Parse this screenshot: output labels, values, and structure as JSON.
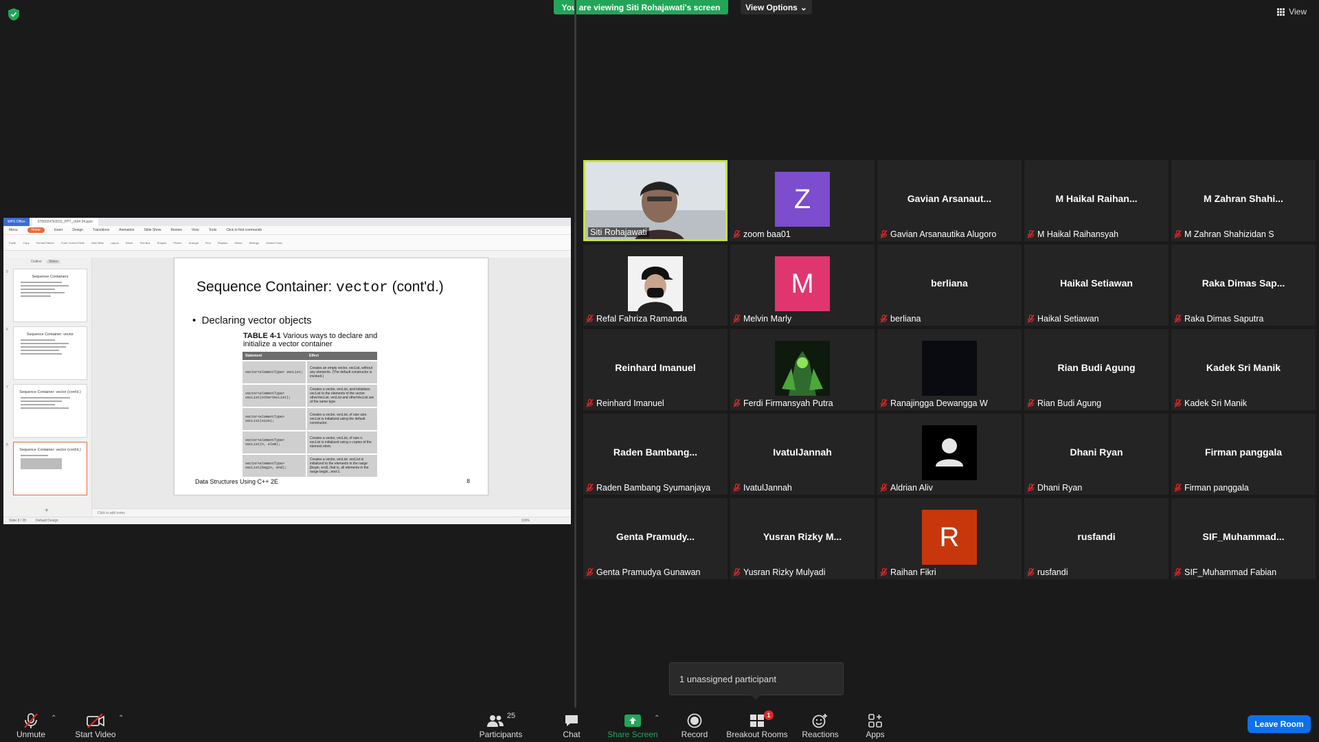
{
  "top": {
    "banner": "You are viewing Siti Rohajawati's screen",
    "view_options": "View Options",
    "view": "View"
  },
  "shared": {
    "app_tab": "WPS Office",
    "doc_tab": "97800247E0011_PPT_ch04 04.pptx",
    "menu": [
      "Menu",
      "Home",
      "Insert",
      "Design",
      "Transitions",
      "Animation",
      "Slide Show",
      "Review",
      "View",
      "Tools",
      "Click to find commands"
    ],
    "ribbon": [
      "Paste",
      "Copy",
      "Format Painter",
      "From Current Slide",
      "New Slide",
      "Layout",
      "Reset",
      "Text Box",
      "Shapes",
      "Picture",
      "Arrange",
      "Find",
      "Replace",
      "Select",
      "Settings",
      "Student Tools"
    ],
    "thumb_tabs": [
      "Outline",
      "Slides"
    ],
    "thumbs": [
      {
        "num": "5",
        "title": "Sequence Containers"
      },
      {
        "num": "6",
        "title": "Sequence Container: vector"
      },
      {
        "num": "7",
        "title": "Sequence Container: vector (cont'd.)"
      },
      {
        "num": "8",
        "title": "Sequence Container: vector (cont'd.)"
      }
    ],
    "slide": {
      "title_a": "Sequence Container: ",
      "title_mono": "vector",
      "title_b": " (cont'd.)",
      "bullet": "Declaring vector objects",
      "caption_bold": "TABLE 4-1",
      "caption_rest": " Various ways to declare and initialize a vector container",
      "col_statement": "Statement",
      "col_effect": "Effect",
      "rows": [
        {
          "stmt": "vector<elementType> vecList;",
          "effect": "Creates an empty vector, vecList, without any elements. (The default constructor is invoked.)"
        },
        {
          "stmt": "vector<elementType> vecList(otherVecList);",
          "effect": "Creates a vector, vecList, and initializes vecList to the elements of the vector otherVecList. vecList and otherVecList are of the same type."
        },
        {
          "stmt": "vector<elementType> vecList(size);",
          "effect": "Creates a vector, vecList, of size size. vecList is initialized using the default constructor."
        },
        {
          "stmt": "vector<elementType> vecList(n, elem);",
          "effect": "Creates a vector, vecList, of size n. vecList is initialized using n copies of the element elem."
        },
        {
          "stmt": "vector<elementType> vecList(begin, end);",
          "effect": "Creates a vector, vecList. vecList is initialized to the elements in the range [begin, end), that is, all elements in the range begin...end-1."
        }
      ],
      "footer": "Data Structures Using C++ 2E",
      "page": "8"
    },
    "notes": "Click to add notes",
    "status_left": "Slide 8 / 28",
    "status_design": "Default Design",
    "zoom": "119%"
  },
  "participants": [
    {
      "display": "",
      "label": "Siti Rohajawati",
      "type": "video",
      "muted": false,
      "speaking": true
    },
    {
      "display": "Z",
      "label": "zoom baa01",
      "type": "avatar",
      "color": "#7c4dcc",
      "muted": true
    },
    {
      "display": "Gavian  Arsanaut...",
      "label": "Gavian Arsanautika Alugoro",
      "type": "name",
      "muted": true
    },
    {
      "display": "M  Haikal  Raihan...",
      "label": "M Haikal Raihansyah",
      "type": "name",
      "muted": true
    },
    {
      "display": "M  Zahran  Shahi...",
      "label": "M Zahran Shahizidan S",
      "type": "name",
      "muted": true
    },
    {
      "display": "",
      "label": "Refal Fahriza Ramanda",
      "type": "photo-cap",
      "muted": true
    },
    {
      "display": "M",
      "label": "Melvin Marly",
      "type": "avatar",
      "color": "#e0356e",
      "muted": true
    },
    {
      "display": "berliana",
      "label": "berliana",
      "type": "name",
      "muted": true
    },
    {
      "display": "Haikal Setiawan",
      "label": "Haikal Setiawan",
      "type": "name",
      "muted": true
    },
    {
      "display": "Raka  Dimas  Sap...",
      "label": "Raka Dimas Saputra",
      "type": "name",
      "muted": true
    },
    {
      "display": "Reinhard Imanuel",
      "label": "Reinhard Imanuel",
      "type": "name",
      "muted": true
    },
    {
      "display": "",
      "label": "Ferdi Firmansyah Putra",
      "type": "photo-green",
      "muted": true
    },
    {
      "display": "",
      "label": "Ranajingga Dewangga W",
      "type": "photo-dark",
      "muted": true
    },
    {
      "display": "Rian Budi Agung",
      "label": "Rian Budi Agung",
      "type": "name",
      "muted": true
    },
    {
      "display": "Kadek Sri Manik",
      "label": "Kadek Sri Manik",
      "type": "name",
      "muted": true
    },
    {
      "display": "Raden  Bambang...",
      "label": "Raden Bambang Syumanjaya",
      "type": "name",
      "muted": true
    },
    {
      "display": "IvatulJannah",
      "label": "IvatulJannah",
      "type": "name",
      "muted": true
    },
    {
      "display": "",
      "label": "Aldrian Aliv",
      "type": "person-icon",
      "muted": true
    },
    {
      "display": "Dhani Ryan",
      "label": "Dhani Ryan",
      "type": "name",
      "muted": true
    },
    {
      "display": "Firman panggala",
      "label": "Firman panggala",
      "type": "name",
      "muted": true
    },
    {
      "display": "Genta  Pramudy...",
      "label": "Genta Pramudya Gunawan",
      "type": "name",
      "muted": true
    },
    {
      "display": "Yusran  Rizky  M...",
      "label": "Yusran Rizky Mulyadi",
      "type": "name",
      "muted": true
    },
    {
      "display": "R",
      "label": "Raihan Fikri",
      "type": "avatar",
      "color": "#c8360c",
      "muted": true
    },
    {
      "display": "rusfandi",
      "label": "rusfandi",
      "type": "name",
      "muted": true
    },
    {
      "display": "SIF_Muhammad...",
      "label": "SIF_Muhammad Fabian",
      "type": "name",
      "muted": true
    }
  ],
  "popup": "1 unassigned participant",
  "toolbar": {
    "unmute": "Unmute",
    "start_video": "Start Video",
    "participants": "Participants",
    "participants_count": "25",
    "chat": "Chat",
    "share": "Share Screen",
    "record": "Record",
    "breakout": "Breakout Rooms",
    "breakout_badge": "1",
    "reactions": "Reactions",
    "apps": "Apps",
    "leave": "Leave Room"
  },
  "colors": {
    "share_green": "#23a559",
    "leave_blue": "#0e71eb",
    "speaking": "#c8e33a"
  }
}
